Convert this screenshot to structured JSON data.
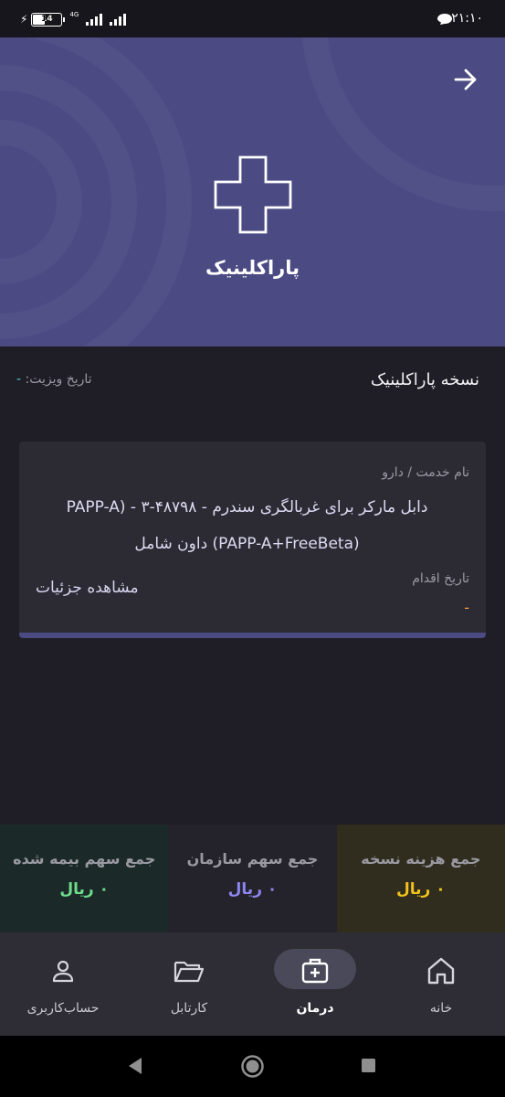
{
  "status_bar": {
    "time": "۲۱:۱۰",
    "battery": "14",
    "network": "4G"
  },
  "hero": {
    "title": "پاراکلینیک",
    "icon": "medical-cross-icon",
    "back_icon": "arrow-right-icon"
  },
  "section": {
    "title": "نسخه پاراکلینیک",
    "visit_date_label": "تاریخ ویزیت:",
    "visit_date_value": "-"
  },
  "card": {
    "service_label": "نام خدمت / دارو",
    "service_name": "دابل مارکر برای غربالگری سندرم - PAPP-A)  - ۳-۴۸۷۹۸ (PAPP-A+FreeBeta) داون شامل",
    "details_link": "مشاهده جزئیات",
    "action_date_label": "تاریخ اقدام",
    "action_date_value": "-"
  },
  "totals": [
    {
      "label": "جمع سهم بیمه شده",
      "value": "۰ ریال",
      "color": "#6fdc8c"
    },
    {
      "label": "جمع سهم سازمان",
      "value": "۰ ریال",
      "color": "#8e86f0"
    },
    {
      "label": "جمع هزینه نسخه",
      "value": "۰ ریال",
      "color": "#f1c21b"
    }
  ],
  "bottom_nav": [
    {
      "label": "حساب‌کاربری",
      "icon": "user-icon"
    },
    {
      "label": "کارتابل",
      "icon": "folder-icon"
    },
    {
      "label": "درمان",
      "icon": "medical-kit-icon",
      "active": true
    },
    {
      "label": "خانه",
      "icon": "home-icon"
    }
  ],
  "colors": {
    "hero_bg": "#4b4a83",
    "page_bg": "#1f1e26",
    "card_bg": "#2c2b33",
    "accent_orange": "#f5a442",
    "accent_teal": "#4fd1c5"
  }
}
